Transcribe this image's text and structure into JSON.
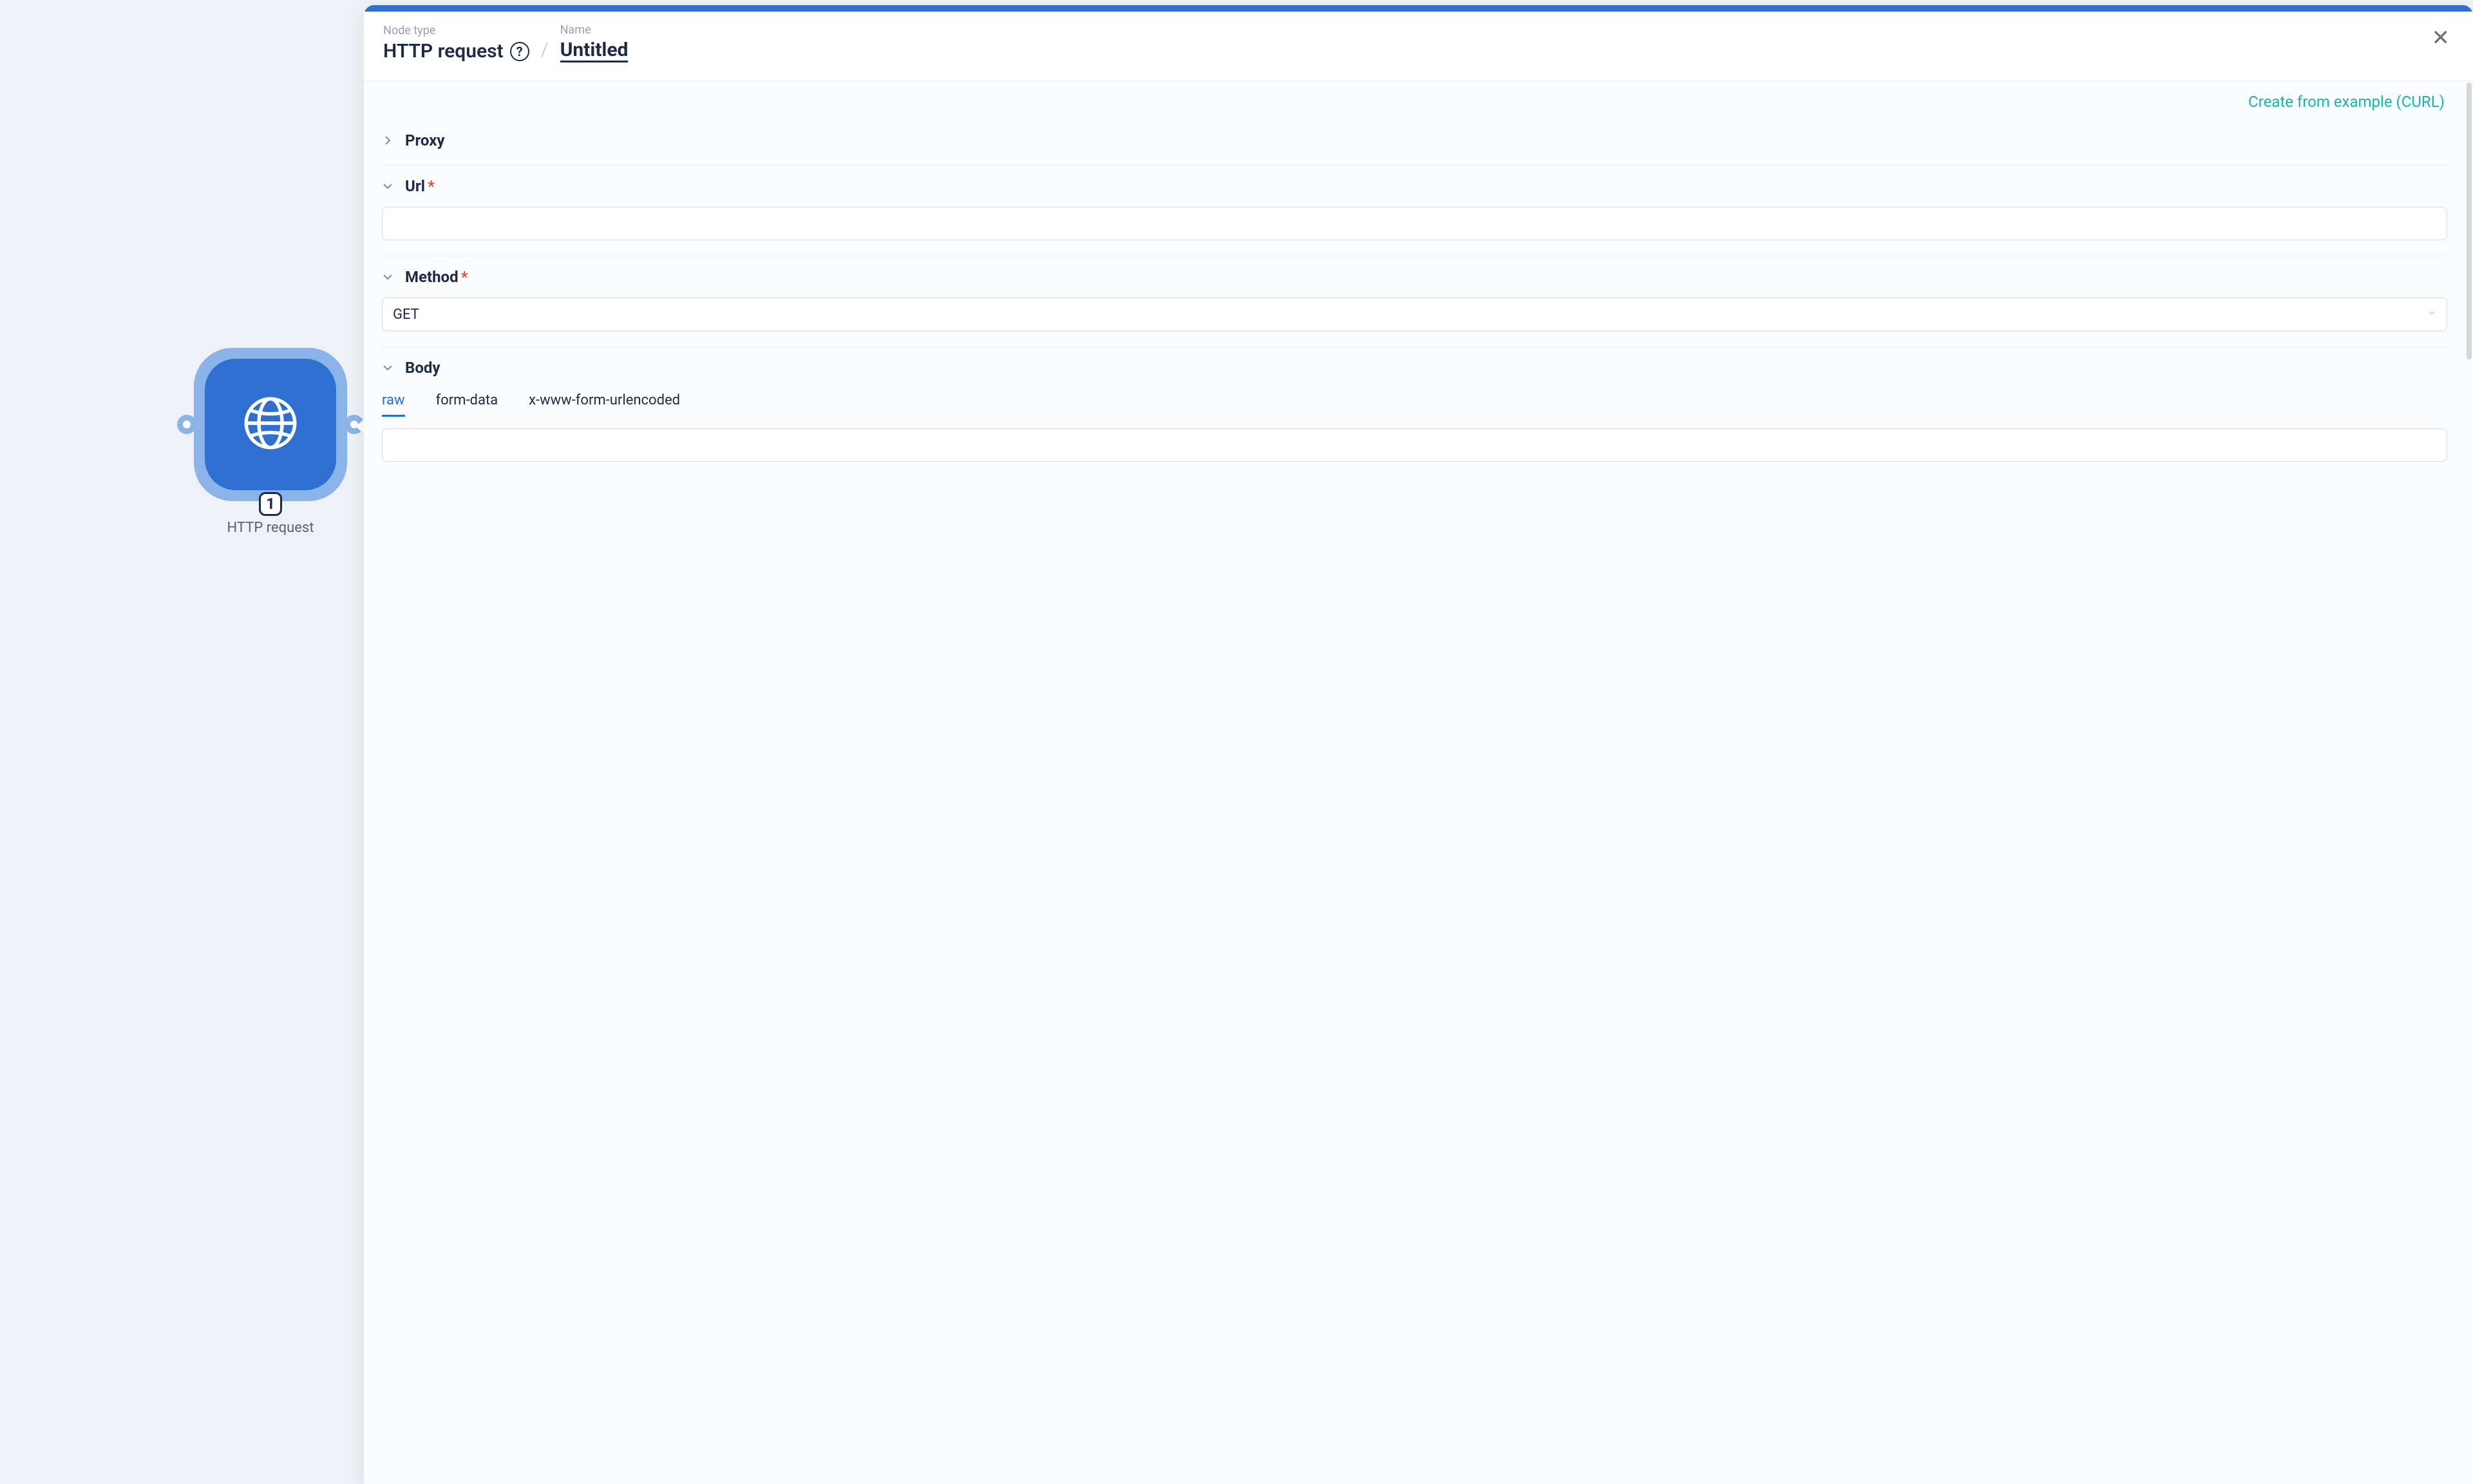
{
  "node": {
    "badge": "1",
    "label": "HTTP request",
    "icon": "globe-icon"
  },
  "header": {
    "nodeTypeLabel": "Node type",
    "nodeTypeValue": "HTTP request",
    "nameLabel": "Name",
    "nameValue": "Untitled"
  },
  "actions": {
    "createFromCurl": "Create from example (CURL)"
  },
  "sections": {
    "proxy": {
      "title": "Proxy",
      "expanded": false
    },
    "url": {
      "title": "Url",
      "required": true,
      "value": ""
    },
    "method": {
      "title": "Method",
      "required": true,
      "value": "GET"
    },
    "body": {
      "title": "Body",
      "tabs": [
        "raw",
        "form-data",
        "x-www-form-urlencoded"
      ],
      "activeTab": "raw",
      "rawValue": ""
    }
  }
}
